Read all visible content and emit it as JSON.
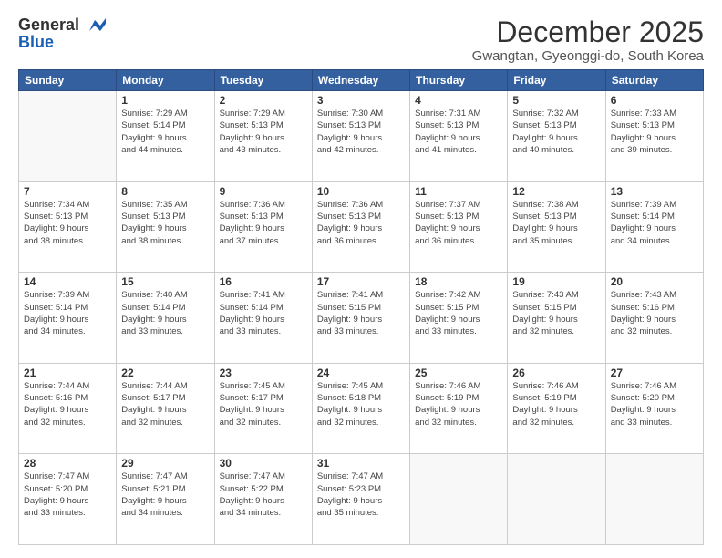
{
  "header": {
    "logo_line1": "General",
    "logo_line2": "Blue",
    "month": "December 2025",
    "location": "Gwangtan, Gyeonggi-do, South Korea"
  },
  "weekdays": [
    "Sunday",
    "Monday",
    "Tuesday",
    "Wednesday",
    "Thursday",
    "Friday",
    "Saturday"
  ],
  "weeks": [
    [
      {
        "day": "",
        "info": ""
      },
      {
        "day": "1",
        "info": "Sunrise: 7:29 AM\nSunset: 5:14 PM\nDaylight: 9 hours\nand 44 minutes."
      },
      {
        "day": "2",
        "info": "Sunrise: 7:29 AM\nSunset: 5:13 PM\nDaylight: 9 hours\nand 43 minutes."
      },
      {
        "day": "3",
        "info": "Sunrise: 7:30 AM\nSunset: 5:13 PM\nDaylight: 9 hours\nand 42 minutes."
      },
      {
        "day": "4",
        "info": "Sunrise: 7:31 AM\nSunset: 5:13 PM\nDaylight: 9 hours\nand 41 minutes."
      },
      {
        "day": "5",
        "info": "Sunrise: 7:32 AM\nSunset: 5:13 PM\nDaylight: 9 hours\nand 40 minutes."
      },
      {
        "day": "6",
        "info": "Sunrise: 7:33 AM\nSunset: 5:13 PM\nDaylight: 9 hours\nand 39 minutes."
      }
    ],
    [
      {
        "day": "7",
        "info": "Sunrise: 7:34 AM\nSunset: 5:13 PM\nDaylight: 9 hours\nand 38 minutes."
      },
      {
        "day": "8",
        "info": "Sunrise: 7:35 AM\nSunset: 5:13 PM\nDaylight: 9 hours\nand 38 minutes."
      },
      {
        "day": "9",
        "info": "Sunrise: 7:36 AM\nSunset: 5:13 PM\nDaylight: 9 hours\nand 37 minutes."
      },
      {
        "day": "10",
        "info": "Sunrise: 7:36 AM\nSunset: 5:13 PM\nDaylight: 9 hours\nand 36 minutes."
      },
      {
        "day": "11",
        "info": "Sunrise: 7:37 AM\nSunset: 5:13 PM\nDaylight: 9 hours\nand 36 minutes."
      },
      {
        "day": "12",
        "info": "Sunrise: 7:38 AM\nSunset: 5:13 PM\nDaylight: 9 hours\nand 35 minutes."
      },
      {
        "day": "13",
        "info": "Sunrise: 7:39 AM\nSunset: 5:14 PM\nDaylight: 9 hours\nand 34 minutes."
      }
    ],
    [
      {
        "day": "14",
        "info": "Sunrise: 7:39 AM\nSunset: 5:14 PM\nDaylight: 9 hours\nand 34 minutes."
      },
      {
        "day": "15",
        "info": "Sunrise: 7:40 AM\nSunset: 5:14 PM\nDaylight: 9 hours\nand 33 minutes."
      },
      {
        "day": "16",
        "info": "Sunrise: 7:41 AM\nSunset: 5:14 PM\nDaylight: 9 hours\nand 33 minutes."
      },
      {
        "day": "17",
        "info": "Sunrise: 7:41 AM\nSunset: 5:15 PM\nDaylight: 9 hours\nand 33 minutes."
      },
      {
        "day": "18",
        "info": "Sunrise: 7:42 AM\nSunset: 5:15 PM\nDaylight: 9 hours\nand 33 minutes."
      },
      {
        "day": "19",
        "info": "Sunrise: 7:43 AM\nSunset: 5:15 PM\nDaylight: 9 hours\nand 32 minutes."
      },
      {
        "day": "20",
        "info": "Sunrise: 7:43 AM\nSunset: 5:16 PM\nDaylight: 9 hours\nand 32 minutes."
      }
    ],
    [
      {
        "day": "21",
        "info": "Sunrise: 7:44 AM\nSunset: 5:16 PM\nDaylight: 9 hours\nand 32 minutes."
      },
      {
        "day": "22",
        "info": "Sunrise: 7:44 AM\nSunset: 5:17 PM\nDaylight: 9 hours\nand 32 minutes."
      },
      {
        "day": "23",
        "info": "Sunrise: 7:45 AM\nSunset: 5:17 PM\nDaylight: 9 hours\nand 32 minutes."
      },
      {
        "day": "24",
        "info": "Sunrise: 7:45 AM\nSunset: 5:18 PM\nDaylight: 9 hours\nand 32 minutes."
      },
      {
        "day": "25",
        "info": "Sunrise: 7:46 AM\nSunset: 5:19 PM\nDaylight: 9 hours\nand 32 minutes."
      },
      {
        "day": "26",
        "info": "Sunrise: 7:46 AM\nSunset: 5:19 PM\nDaylight: 9 hours\nand 32 minutes."
      },
      {
        "day": "27",
        "info": "Sunrise: 7:46 AM\nSunset: 5:20 PM\nDaylight: 9 hours\nand 33 minutes."
      }
    ],
    [
      {
        "day": "28",
        "info": "Sunrise: 7:47 AM\nSunset: 5:20 PM\nDaylight: 9 hours\nand 33 minutes."
      },
      {
        "day": "29",
        "info": "Sunrise: 7:47 AM\nSunset: 5:21 PM\nDaylight: 9 hours\nand 34 minutes."
      },
      {
        "day": "30",
        "info": "Sunrise: 7:47 AM\nSunset: 5:22 PM\nDaylight: 9 hours\nand 34 minutes."
      },
      {
        "day": "31",
        "info": "Sunrise: 7:47 AM\nSunset: 5:23 PM\nDaylight: 9 hours\nand 35 minutes."
      },
      {
        "day": "",
        "info": ""
      },
      {
        "day": "",
        "info": ""
      },
      {
        "day": "",
        "info": ""
      }
    ]
  ]
}
